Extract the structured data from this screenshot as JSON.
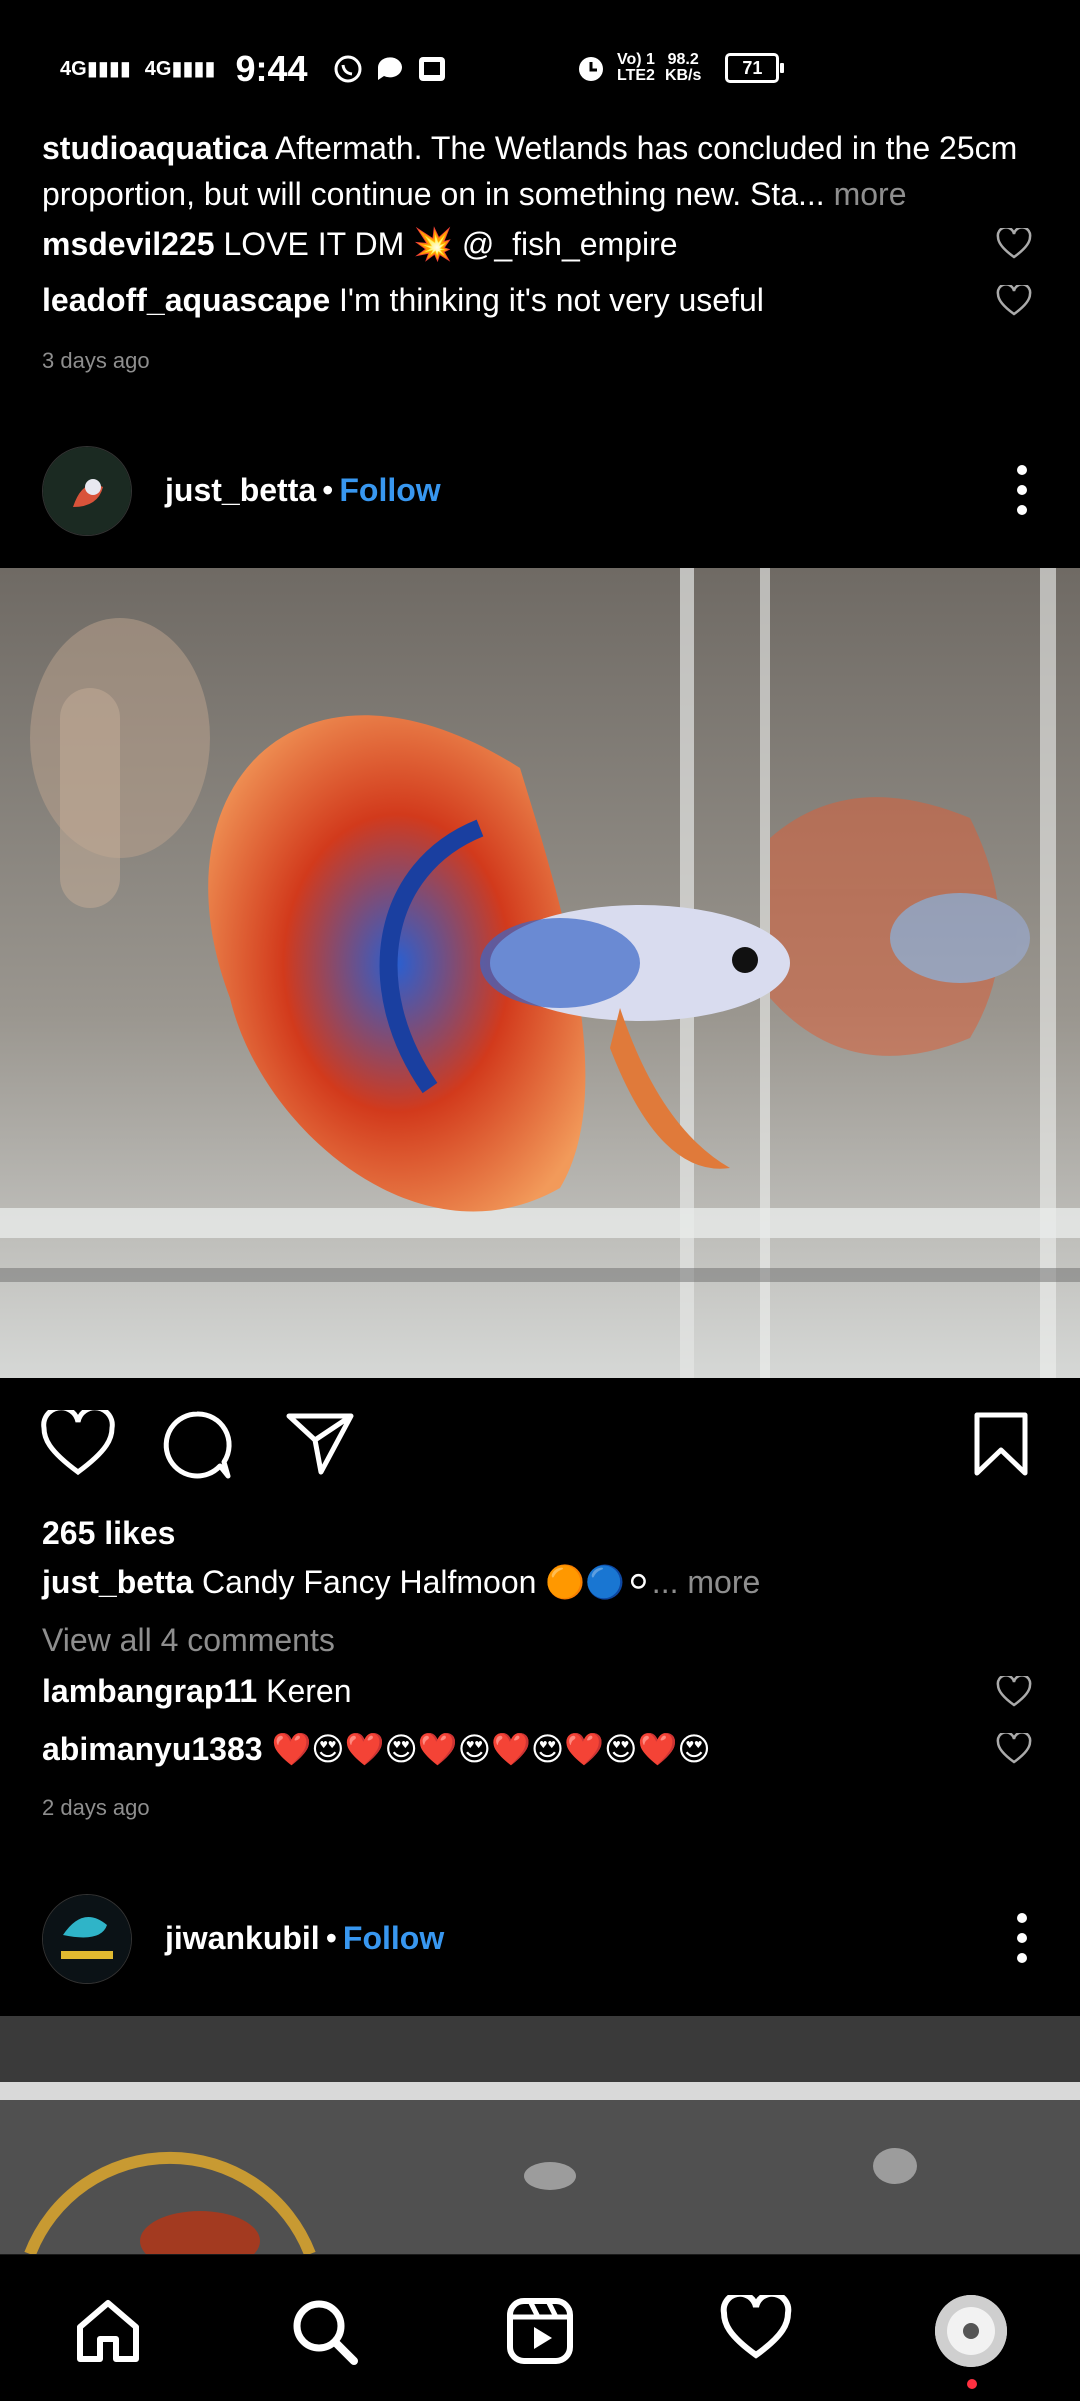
{
  "status_bar": {
    "signal1": "4G",
    "signal2": "4G",
    "time": "9:44",
    "volte_top": "Vo) 1",
    "volte_bottom": "LTE2",
    "speed_value": "98.2",
    "speed_unit": "KB/s",
    "battery": "71"
  },
  "post1": {
    "caption_user": "studioaquatica",
    "caption_text": "Aftermath. The Wetlands has concluded in the 25cm proportion, but will continue on in something new. Sta...",
    "caption_more": "more",
    "comments": [
      {
        "user": "msdevil225",
        "text": "LOVE IT DM 💥 @_fish_empire"
      },
      {
        "user": "leadoff_aquascape",
        "text": "I'm thinking it's not very useful"
      }
    ],
    "time_ago": "3 days ago"
  },
  "post2": {
    "username": "just_betta",
    "separator": "•",
    "follow_label": "Follow",
    "likes": "265 likes",
    "caption_user": "just_betta",
    "caption_text": "Candy Fancy Halfmoon 🟠🔵⚪",
    "caption_more": "... more",
    "view_all": "View all 4 comments",
    "comments": [
      {
        "user": "lambangrap11",
        "text": "Keren"
      },
      {
        "user": "abimanyu1383",
        "text": "❤️😍❤️😍❤️😍❤️😍❤️😍❤️😍"
      }
    ],
    "time_ago": "2 days ago"
  },
  "post3": {
    "username": "jiwankubil",
    "separator": "•",
    "follow_label": "Follow"
  },
  "nav": {
    "items": [
      "home-icon",
      "search-icon",
      "reels-icon",
      "activity-heart-icon",
      "profile-avatar"
    ]
  },
  "colors": {
    "follow_blue": "#3897f0",
    "muted_gray": "#8e8e8e",
    "notification_dot": "#ff3040"
  }
}
